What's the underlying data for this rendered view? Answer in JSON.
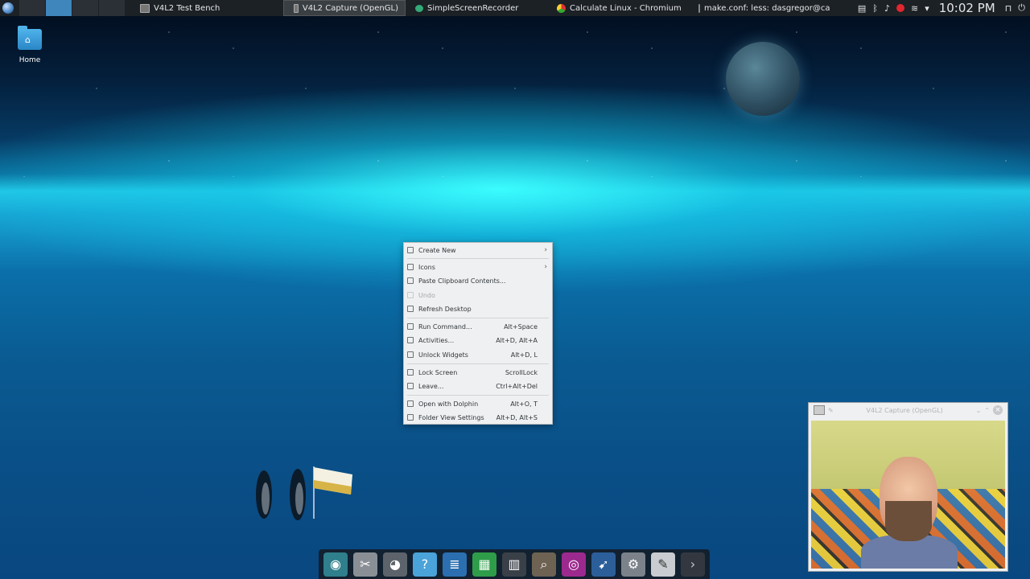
{
  "panel": {
    "tasks": [
      {
        "title": "V4L2 Test Bench",
        "icon": "window-icon",
        "active": false
      },
      {
        "title": "V4L2 Capture (OpenGL)",
        "icon": "window-icon",
        "active": true
      },
      {
        "title": "SimpleScreenRecorder",
        "icon": "ssr-icon",
        "active": false
      },
      {
        "title": "Calculate Linux - Chromium",
        "icon": "chromium-icon",
        "active": false
      },
      {
        "title": "make.conf: less: dasgregor@calcu",
        "icon": "terminal-icon",
        "active": false
      }
    ],
    "clock": "10:02 PM"
  },
  "desktop": {
    "home_label": "Home"
  },
  "context_menu": {
    "items": [
      {
        "label": "Create New",
        "shortcut": "",
        "submenu": true,
        "disabled": false
      },
      {
        "label": "Icons",
        "shortcut": "",
        "submenu": true,
        "disabled": false
      },
      {
        "label": "Paste Clipboard Contents...",
        "shortcut": "",
        "submenu": false,
        "disabled": false
      },
      {
        "label": "Undo",
        "shortcut": "",
        "submenu": false,
        "disabled": true
      },
      {
        "label": "Refresh Desktop",
        "shortcut": "",
        "submenu": false,
        "disabled": false
      },
      {
        "label": "Run Command...",
        "shortcut": "Alt+Space",
        "submenu": false,
        "disabled": false
      },
      {
        "label": "Activities...",
        "shortcut": "Alt+D, Alt+A",
        "submenu": false,
        "disabled": false
      },
      {
        "label": "Unlock Widgets",
        "shortcut": "Alt+D, L",
        "submenu": false,
        "disabled": false
      },
      {
        "label": "Lock Screen",
        "shortcut": "ScrollLock",
        "submenu": false,
        "disabled": false
      },
      {
        "label": "Leave...",
        "shortcut": "Ctrl+Alt+Del",
        "submenu": false,
        "disabled": false
      },
      {
        "label": "Open with Dolphin",
        "shortcut": "Alt+O, T",
        "submenu": false,
        "disabled": false
      },
      {
        "label": "Folder View Settings",
        "shortcut": "Alt+D, Alt+S",
        "submenu": false,
        "disabled": false
      }
    ]
  },
  "webcam_window": {
    "title": "V4L2 Capture (OpenGL)"
  },
  "colors": {
    "accent": "#3f86bc",
    "panel_bg": "#1c2126",
    "menu_bg": "#eff0f1",
    "record": "#e0262e"
  }
}
